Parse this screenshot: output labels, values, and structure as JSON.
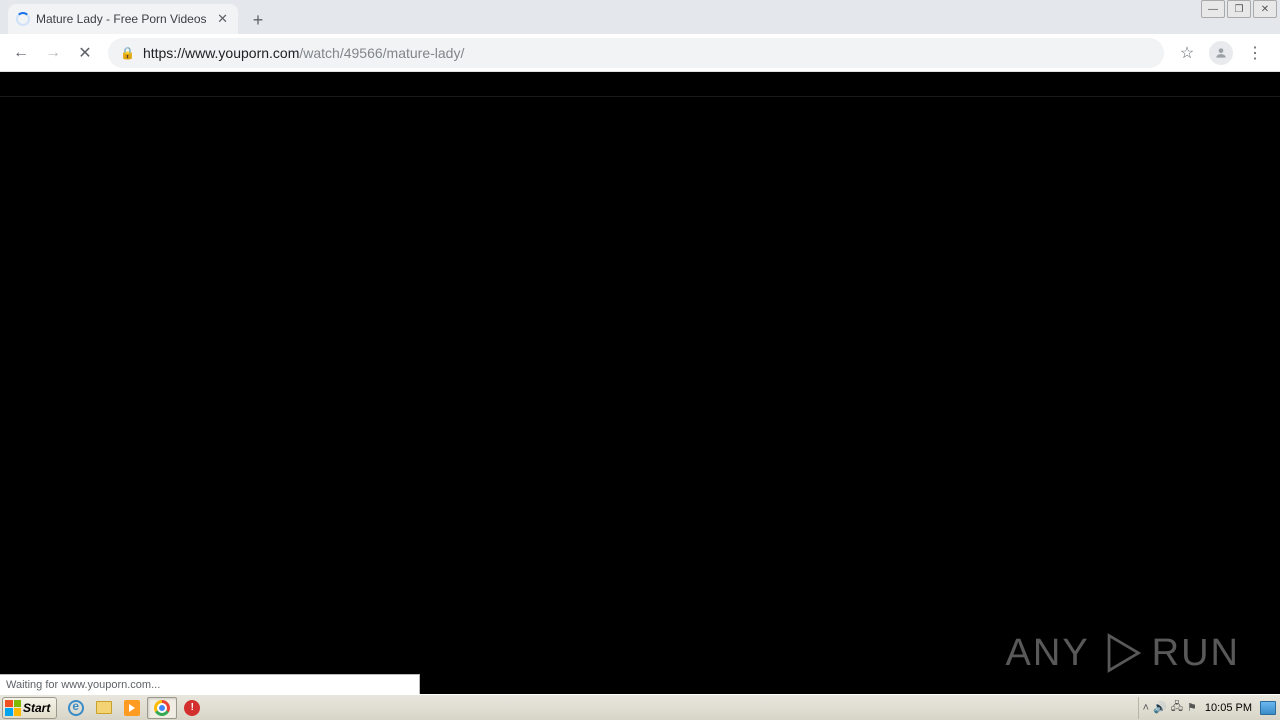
{
  "window": {
    "controls": {
      "min": "—",
      "max": "❐",
      "close": "✕"
    }
  },
  "tab": {
    "title": "Mature Lady - Free Porn Videos - Yo",
    "close": "✕"
  },
  "newtab_label": "+",
  "nav": {
    "back": "←",
    "forward": "→",
    "stop": "✕"
  },
  "url": {
    "scheme_host": "https://www.youporn.com",
    "path": "/watch/49566/mature-lady/"
  },
  "toolbar_icons": {
    "bookmark": "☆",
    "menu": "⋮"
  },
  "status_text": "Waiting for www.youporn.com...",
  "watermark": {
    "left": "ANY",
    "right": "RUN"
  },
  "taskbar": {
    "start_label": "Start",
    "red_icon_char": "!",
    "tray": {
      "up": "˄",
      "vol": "🔊",
      "net": "🖧",
      "flag": "⚑"
    },
    "clock": "10:05 PM"
  }
}
